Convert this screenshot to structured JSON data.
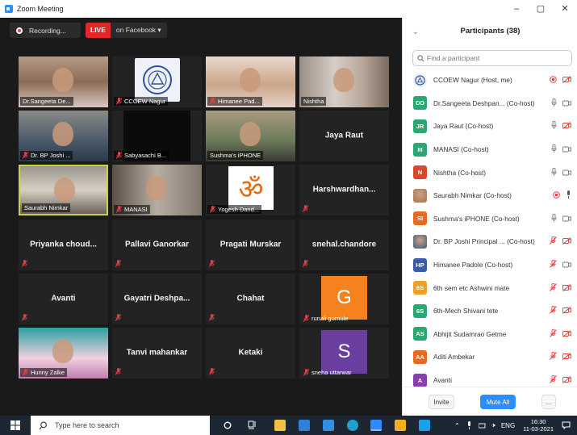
{
  "window": {
    "title": "Zoom Meeting",
    "controls": [
      "–",
      "▢",
      "✕"
    ]
  },
  "toolbar": {
    "recording_label": "Recording...",
    "live_label": "LIVE",
    "live_target": "on Facebook ▾"
  },
  "tiles": [
    {
      "name": "Dr.Sangeeta De...",
      "type": "video"
    },
    {
      "name": "CCOEW Nagur",
      "type": "logo",
      "muted": true
    },
    {
      "name": "Himanee Pad...",
      "type": "video",
      "muted": true
    },
    {
      "name": "Nishtha",
      "type": "video"
    },
    {
      "name": "Dr. BP Joshi ...",
      "type": "video",
      "muted": true
    },
    {
      "name": "Sabyasachi B...",
      "type": "video-dark",
      "muted": true
    },
    {
      "name": "Sushma's iPHONE",
      "type": "video"
    },
    {
      "name": "Jaya Raut",
      "type": "name"
    },
    {
      "name": "Saurabh Nimkar",
      "type": "video",
      "active": true
    },
    {
      "name": "MANASI",
      "type": "video",
      "muted": true
    },
    {
      "name": "Yogesh Dand...",
      "type": "om",
      "muted": true
    },
    {
      "name": "Harshwardhan...",
      "type": "name",
      "muted": true
    },
    {
      "name": "Priyanka  choud...",
      "type": "name",
      "muted": true
    },
    {
      "name": "Pallavi Ganorkar",
      "type": "name",
      "muted": true
    },
    {
      "name": "Pragati Murskar",
      "type": "name",
      "muted": true
    },
    {
      "name": "snehal.chandore",
      "type": "name",
      "muted": true
    },
    {
      "name": "Avanti",
      "type": "name",
      "muted": true
    },
    {
      "name": "Gayatri  Deshpa...",
      "type": "name",
      "muted": true
    },
    {
      "name": "Chahat",
      "type": "name",
      "muted": true
    },
    {
      "name": "runali gurnule",
      "type": "letter",
      "letter": "G",
      "color": "#f5821f",
      "muted": true
    },
    {
      "name": "Hunny Zalke",
      "type": "video",
      "muted": true
    },
    {
      "name": "Tanvi mahankar",
      "type": "name",
      "muted": true
    },
    {
      "name": "Ketaki",
      "type": "name",
      "muted": true
    },
    {
      "name": "sneha uttarwar",
      "type": "letter",
      "letter": "S",
      "color": "#6b3fa0",
      "muted": true
    }
  ],
  "panel": {
    "title": "Participants (38)",
    "collapse_icon": "⌄",
    "search_placeholder": "Find a participant",
    "participants": [
      {
        "name": "CCOEW Nagur (Host, me)",
        "initials": "",
        "color": "#e9eef7",
        "mic": "rec",
        "video": "off",
        "img": "logo"
      },
      {
        "name": "Dr.Sangeeta Deshpan... (Co-host)",
        "initials": "DD",
        "color": "#29a872",
        "mic": "on",
        "video": "on"
      },
      {
        "name": "Jaya Raut (Co-host)",
        "initials": "JR",
        "color": "#29a872",
        "mic": "on",
        "video": "off"
      },
      {
        "name": "MANASI (Co-host)",
        "initials": "M",
        "color": "#29a872",
        "mic": "on",
        "video": "on"
      },
      {
        "name": "Nishtha (Co-host)",
        "initials": "N",
        "color": "#d94a2b",
        "mic": "on",
        "video": "on"
      },
      {
        "name": "Saurabh Nimkar (Co-host)",
        "initials": "",
        "color": "#b08060",
        "mic": "rec",
        "video": "mic",
        "img": "photo"
      },
      {
        "name": "Sushma's iPHONE (Co-host)",
        "initials": "SI",
        "color": "#e66a1f",
        "mic": "on",
        "video": "on"
      },
      {
        "name": "Dr. BP Joshi Principal ... (Co-host)",
        "initials": "",
        "color": "#607080",
        "mic": "off",
        "video": "off",
        "img": "photo"
      },
      {
        "name": "Himanee Padole (Co-host)",
        "initials": "HP",
        "color": "#3b5ba9",
        "mic": "off",
        "video": "on"
      },
      {
        "name": "6th sem etc Ashwini mate",
        "initials": "6S",
        "color": "#f0a020",
        "mic": "off",
        "video": "off"
      },
      {
        "name": "6th-Mech Shivani tete",
        "initials": "6S",
        "color": "#29a872",
        "mic": "off",
        "video": "off"
      },
      {
        "name": "Abhijit Sudamrao Getme",
        "initials": "AS",
        "color": "#29a872",
        "mic": "off",
        "video": "off"
      },
      {
        "name": "Aditi Ambekar",
        "initials": "AA",
        "color": "#e66a1f",
        "mic": "off",
        "video": "off"
      },
      {
        "name": "Avanti",
        "initials": "A",
        "color": "#8a3fb0",
        "mic": "off",
        "video": "off"
      }
    ],
    "invite_label": "Invite",
    "mute_all_label": "Mute All",
    "more_label": "..."
  },
  "taskbar": {
    "search_placeholder": "Type here to search",
    "lang": "ENG",
    "time": "16:30",
    "date": "11-03-2021"
  }
}
